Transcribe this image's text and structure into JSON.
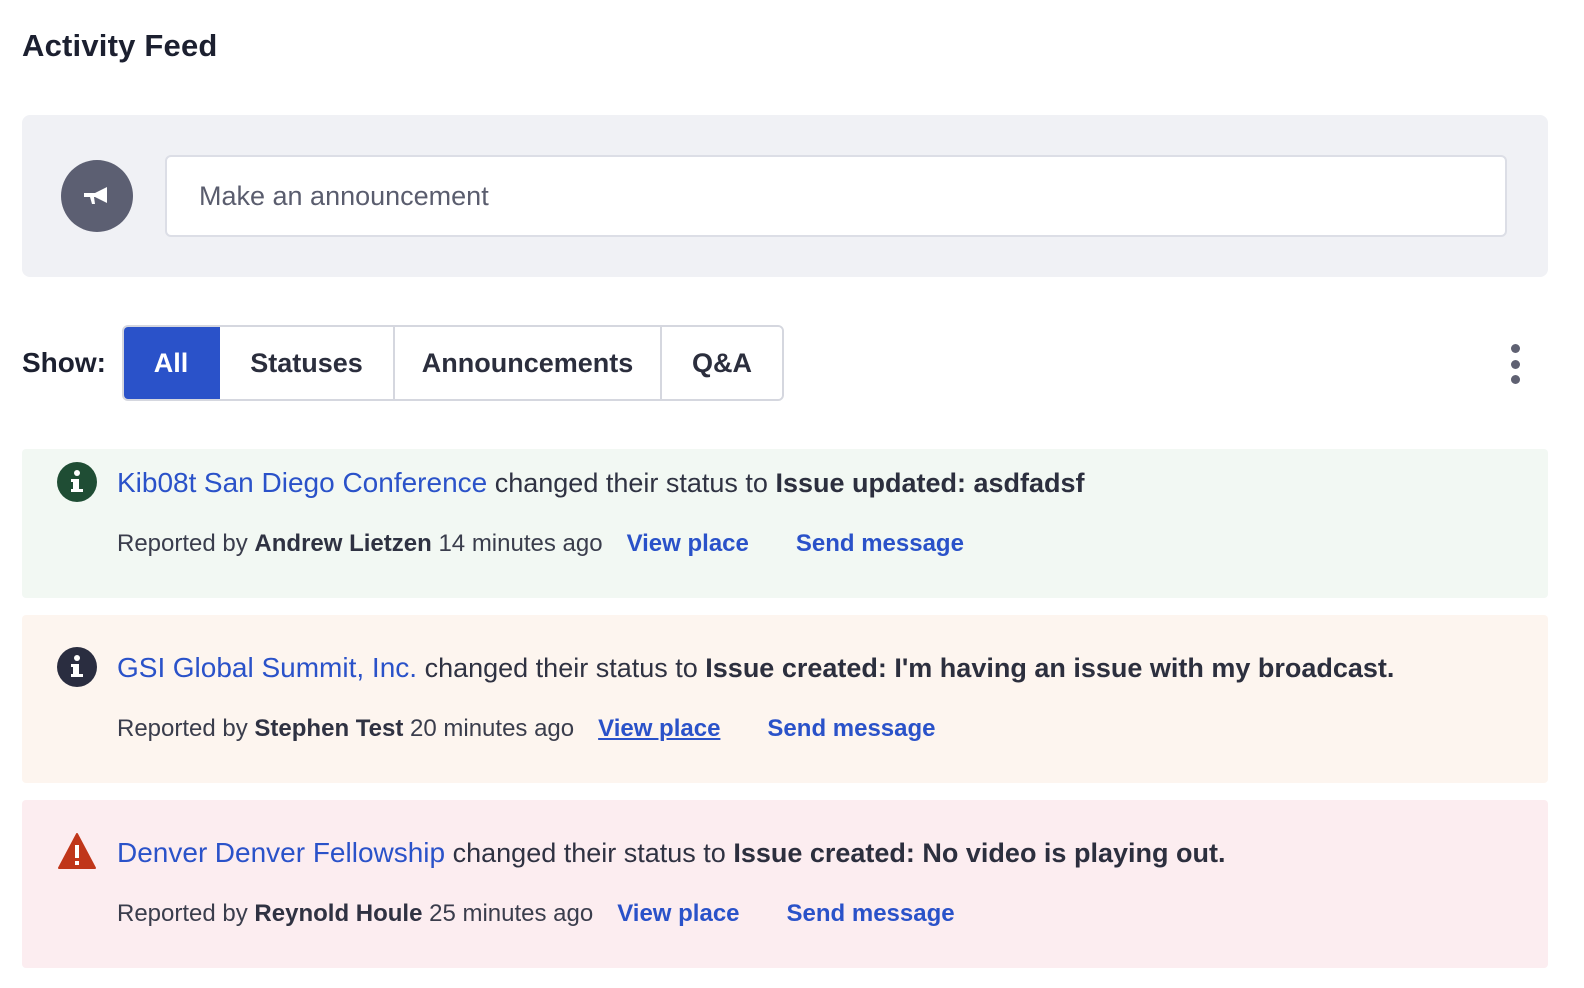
{
  "page": {
    "title": "Activity Feed"
  },
  "announcement": {
    "icon": "megaphone-icon",
    "placeholder": "Make an announcement"
  },
  "filter": {
    "label": "Show:",
    "options": [
      "All",
      "Statuses",
      "Announcements",
      "Q&A"
    ],
    "selected": "All",
    "more_icon": "more-vertical-icon"
  },
  "colors": {
    "accent": "#2a52c9",
    "info_bg": "#f2f8f3",
    "warning_bg": "#fdf5ef",
    "error_bg": "#fcedf0",
    "info_icon": "#1f4d34",
    "neutral_icon": "#2a2d40",
    "error_icon": "#c0361a"
  },
  "feed": [
    {
      "icon": "info-icon",
      "org": "Kib08t",
      "place": "San Diego Conference",
      "action": "changed their status to",
      "message": "Issue updated: asdfadsf",
      "reported_prefix": "Reported by",
      "reporter": "Andrew Lietzen",
      "time": "14 minutes ago",
      "view_label": "View place",
      "send_label": "Send message"
    },
    {
      "icon": "info-icon",
      "org": "GSI",
      "place": "Global Summit, Inc.",
      "action": "changed their status to",
      "message": "Issue created: I'm having an issue with my broadcast.",
      "reported_prefix": "Reported by",
      "reporter": "Stephen Test",
      "time": "20 minutes ago",
      "view_label": "View place",
      "send_label": "Send message"
    },
    {
      "icon": "warning-icon",
      "org": "Denver",
      "place": "Denver Fellowship",
      "action": "changed their status to",
      "message": "Issue created: No video is playing out.",
      "reported_prefix": "Reported by",
      "reporter": "Reynold Houle",
      "time": "25 minutes ago",
      "view_label": "View place",
      "send_label": "Send message"
    }
  ]
}
